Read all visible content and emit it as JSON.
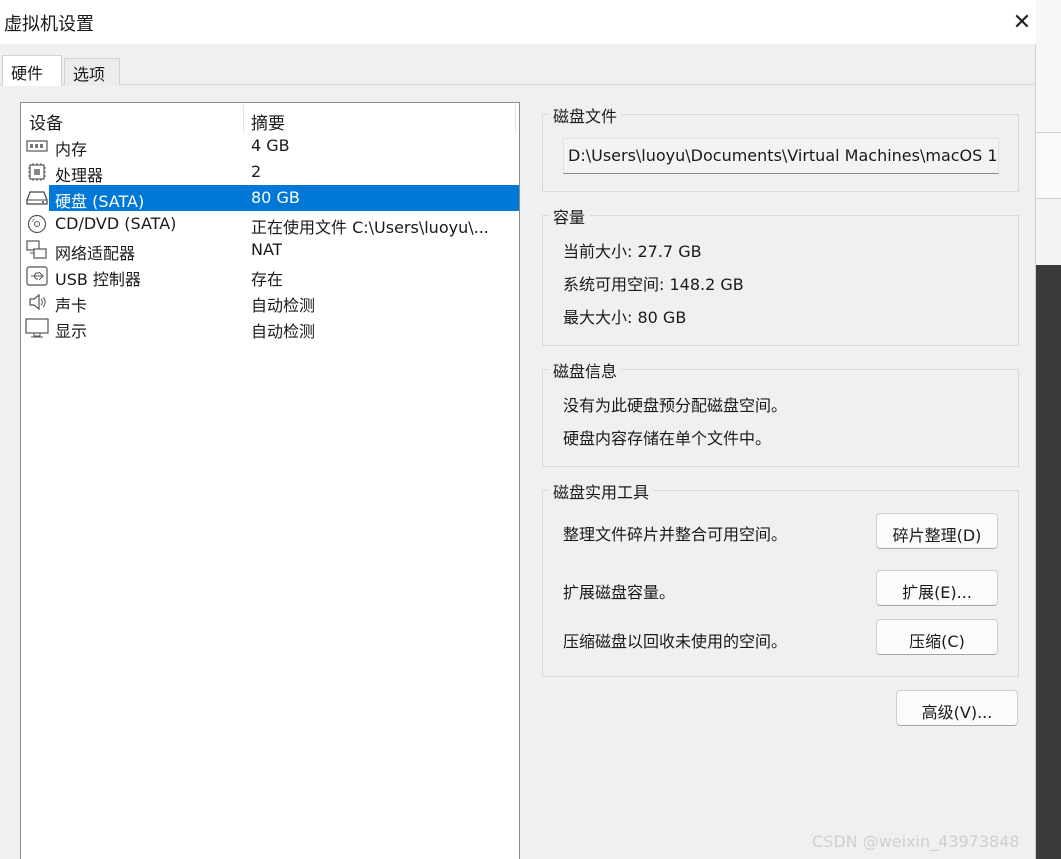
{
  "window": {
    "title": "虚拟机设置",
    "close_glyph": "✕"
  },
  "tabs": [
    {
      "label": "硬件",
      "active": true
    },
    {
      "label": "选项",
      "active": false
    }
  ],
  "device_list": {
    "headers": {
      "device": "设备",
      "summary": "摘要"
    },
    "rows": [
      {
        "name": "内存",
        "summary": "4 GB",
        "icon": "memory-icon",
        "selected": false
      },
      {
        "name": "处理器",
        "summary": "2",
        "icon": "processor-icon",
        "selected": false
      },
      {
        "name": "硬盘 (SATA)",
        "summary": "80 GB",
        "icon": "hard-disk-icon",
        "selected": true
      },
      {
        "name": "CD/DVD (SATA)",
        "summary": "正在使用文件 C:\\Users\\luoyu\\...",
        "icon": "cd-dvd-icon",
        "selected": false
      },
      {
        "name": "网络适配器",
        "summary": "NAT",
        "icon": "network-adapter-icon",
        "selected": false
      },
      {
        "name": "USB 控制器",
        "summary": "存在",
        "icon": "usb-icon",
        "selected": false
      },
      {
        "name": "声卡",
        "summary": "自动检测",
        "icon": "speaker-icon",
        "selected": false
      },
      {
        "name": "显示",
        "summary": "自动检测",
        "icon": "monitor-icon",
        "selected": false
      }
    ]
  },
  "disk_file": {
    "title": "磁盘文件",
    "path": "D:\\Users\\luoyu\\Documents\\Virtual Machines\\macOS 1"
  },
  "capacity": {
    "title": "容量",
    "current_size": "当前大小: 27.7 GB",
    "available_space": "系统可用空间: 148.2 GB",
    "max_size": "最大大小: 80 GB"
  },
  "disk_info": {
    "title": "磁盘信息",
    "line1": "没有为此硬盘预分配磁盘空间。",
    "line2": "硬盘内容存储在单个文件中。"
  },
  "disk_utilities": {
    "title": "磁盘实用工具",
    "defrag_text": "整理文件碎片并整合可用空间。",
    "defrag_button": "碎片整理(D)",
    "expand_text": "扩展磁盘容量。",
    "expand_button": "扩展(E)...",
    "compact_text": "压缩磁盘以回收未使用的空间。",
    "compact_button": "压缩(C)"
  },
  "advanced_button": "高级(V)...",
  "watermark": "CSDN @weixin_43973848",
  "colors": {
    "selection": "#0078d7",
    "dialog_bg": "#f0f0f0"
  }
}
